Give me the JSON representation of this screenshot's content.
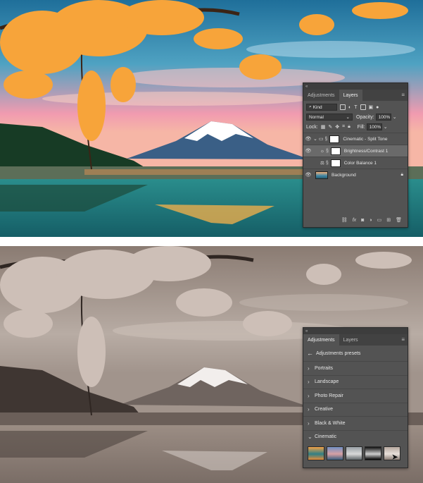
{
  "colors": {
    "panel_bg": "#535353",
    "panel_dark": "#424242",
    "sky_top": "#2a7fa6",
    "sky_pink": "#f59aa8",
    "blossom": "#f6a23c",
    "water": "#1f7f86",
    "sepia": "#9b8a7f"
  },
  "top_panel": {
    "tabs": [
      "Adjustments",
      "Layers"
    ],
    "active_tab": "Layers",
    "filter_label": "Kind",
    "blend_mode": "Normal",
    "opacity_label": "Opacity:",
    "opacity_value": "100%",
    "lock_label": "Lock:",
    "fill_label": "Fill:",
    "fill_value": "100%",
    "layers": [
      {
        "name": "Cinematic - Split Tone",
        "kind": "group"
      },
      {
        "name": "Brightness/Contrast 1",
        "kind": "adjustment",
        "icon": "sun-icon",
        "selected": true
      },
      {
        "name": "Color Balance 1",
        "kind": "adjustment",
        "icon": "balance-icon"
      },
      {
        "name": "Background",
        "kind": "image",
        "locked": true
      }
    ],
    "bottom_icons": [
      "link-icon",
      "fx-icon",
      "mask-icon",
      "adjustment-icon",
      "folder-icon",
      "new-layer-icon",
      "trash-icon"
    ]
  },
  "bottom_panel": {
    "tabs": [
      "Adjustments",
      "Layers"
    ],
    "active_tab": "Adjustments",
    "back_label": "Adjustments presets",
    "groups": [
      "Portraits",
      "Landscape",
      "Photo Repair",
      "Creative",
      "Black & White",
      "Cinematic"
    ],
    "expanded_group": "Cinematic",
    "preset_thumbs": [
      "teal-orange",
      "blue-dusk",
      "faded",
      "noir",
      "sepia"
    ]
  }
}
